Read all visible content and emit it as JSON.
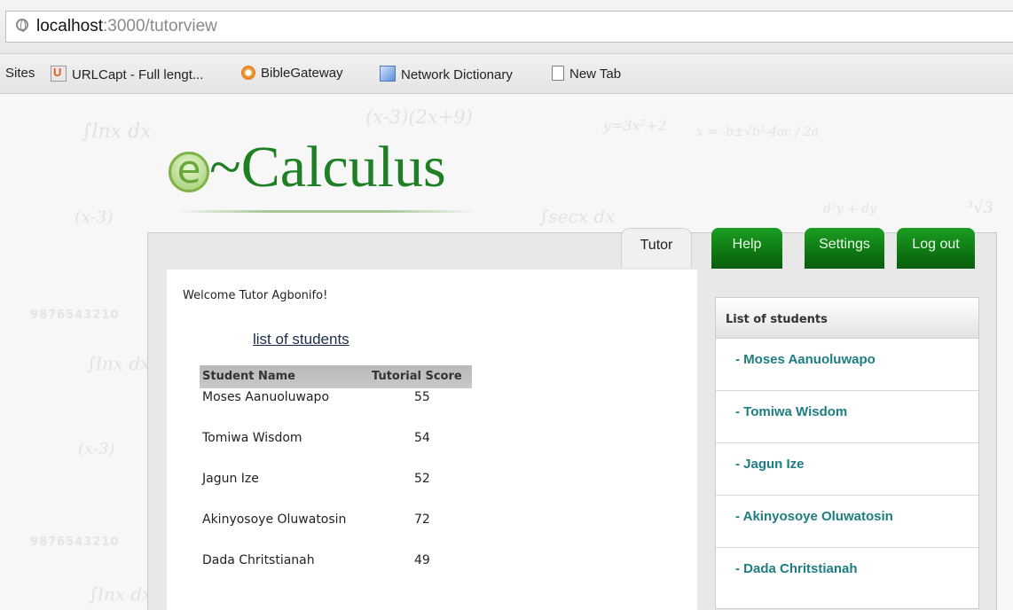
{
  "browser": {
    "url_host": "localhost",
    "url_path": ":3000/tutorview",
    "bookmarks": [
      {
        "label": "Sites",
        "icon": "none"
      },
      {
        "label": "URLCapt - Full lengt...",
        "icon": "urlcapt-icon"
      },
      {
        "label": "BibleGateway",
        "icon": "biblegateway-icon"
      },
      {
        "label": "Network Dictionary",
        "icon": "network-dictionary-icon"
      },
      {
        "label": "New Tab",
        "icon": "page-icon"
      }
    ]
  },
  "header": {
    "logo_e": "e",
    "logo_text": "~Calculus"
  },
  "nav": {
    "tabs": [
      "Tutor",
      "Help",
      "Settings",
      "Log out"
    ],
    "active": "Tutor",
    "active_color": "#f0f0f0",
    "button_color": "#0f7a13"
  },
  "main": {
    "welcome": "Welcome Tutor Agbonifo!",
    "list_heading": "list of students",
    "table": {
      "headers": [
        "Student Name",
        "Tutorial Score"
      ],
      "rows": [
        {
          "name": "Moses Aanuoluwapo",
          "score": "55"
        },
        {
          "name": "Tomiwa Wisdom",
          "score": "54"
        },
        {
          "name": "Jagun Ize",
          "score": "52"
        },
        {
          "name": "Akinyosoye Oluwatosin",
          "score": "72"
        },
        {
          "name": "Dada Chritstianah",
          "score": "49"
        }
      ]
    }
  },
  "sidebar": {
    "title": "List of students",
    "items": [
      "- Moses Aanuoluwapo",
      "- Tomiwa Wisdom",
      "- Jagun Ize",
      "- Akinyosoye Oluwatosin",
      "- Dada Chritstianah"
    ],
    "link_color": "#1e7d80"
  },
  "background_decor": {
    "math": [
      "∫lnx dx",
      "(x-3)(2x+9)",
      "y=3x²+2",
      "x = -b±√b²-4ac / 2a",
      "(x-3)",
      "∫secx dx",
      "d²y + dy",
      "³√3",
      "∫lnx dx",
      "(x-3)",
      "∫lnx dx"
    ],
    "digits": [
      "9876543210",
      "9876543210"
    ]
  }
}
